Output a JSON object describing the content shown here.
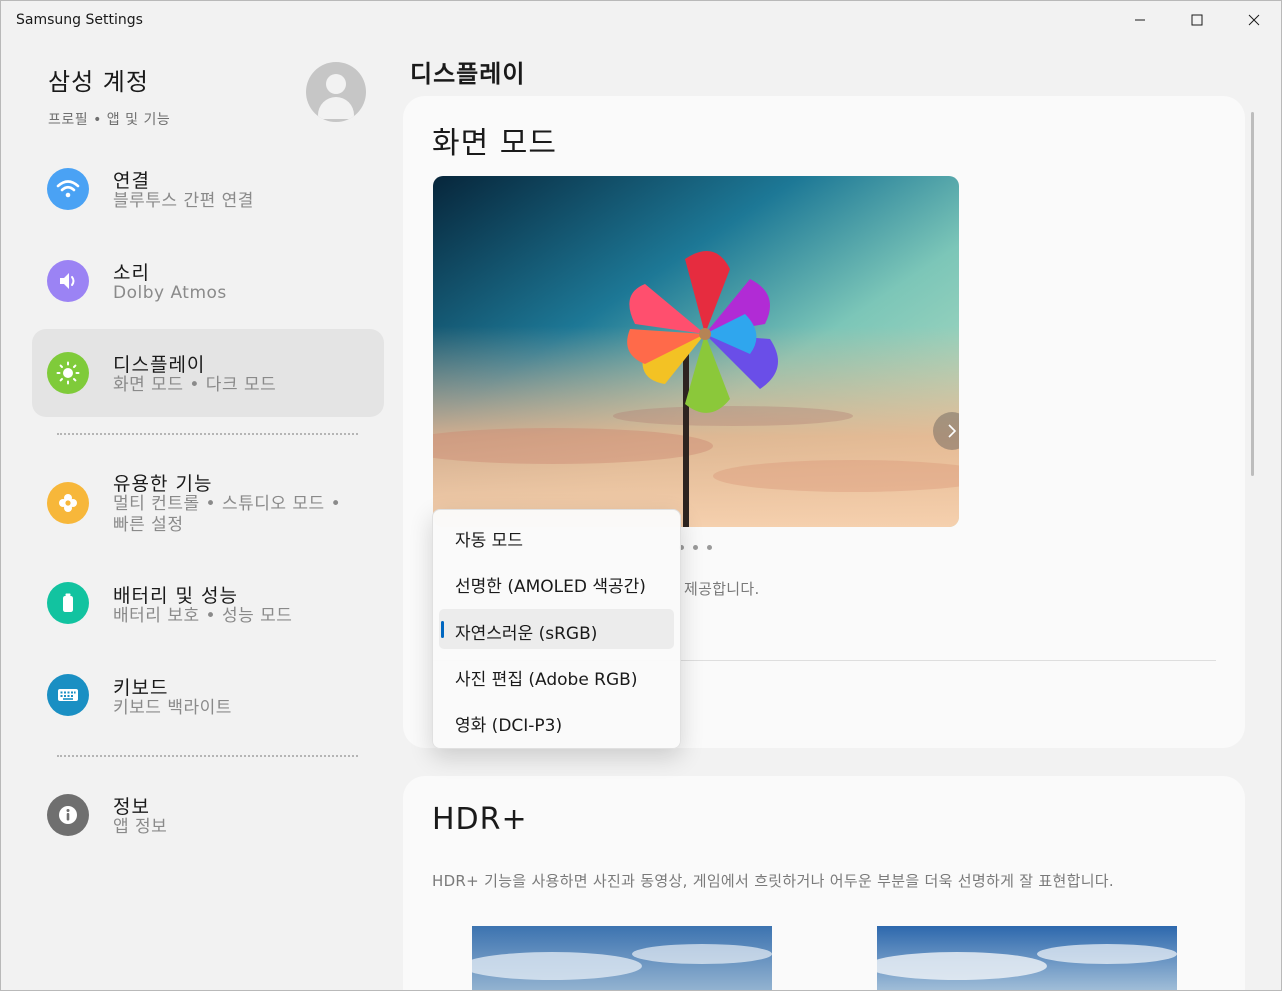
{
  "window": {
    "title": "Samsung Settings",
    "controls": [
      "minimize",
      "maximize",
      "close"
    ]
  },
  "account": {
    "name": "삼성 계정",
    "subtitle": "프로필 • 앱 및 기능"
  },
  "sidebar": {
    "items": [
      {
        "title": "연결",
        "subtitle": "블루투스 간편 연결",
        "icon": "wifi-icon",
        "color": "#4aa2f4"
      },
      {
        "title": "소리",
        "subtitle": "Dolby Atmos",
        "icon": "speaker-icon",
        "color": "#9b83f4"
      },
      {
        "title": "디스플레이",
        "subtitle": "화면 모드 • 다크 모드",
        "icon": "brightness-icon",
        "color": "#7fcb3a",
        "selected": true
      },
      {
        "title": "유용한 기능",
        "subtitle_line1": "멀티 컨트롤 • 스튜디오 모드 •",
        "subtitle_line2": "빠른 설정",
        "icon": "flower-icon",
        "color": "#f7b73a"
      },
      {
        "title": "배터리 및 성능",
        "subtitle": "배터리 보호 • 성능 모드",
        "icon": "battery-icon",
        "color": "#12c3a0"
      },
      {
        "title": "키보드",
        "subtitle": "키보드 백라이트",
        "icon": "keyboard-icon",
        "color": "#1a8fc3"
      },
      {
        "title": "정보",
        "subtitle": "앱 정보",
        "icon": "info-icon",
        "color": "#6f6f6f"
      }
    ]
  },
  "main": {
    "page_title": "디스플레이",
    "screen_mode": {
      "title": "화면 모드",
      "description_visible": "제공합니다.",
      "carousel_pages": 3
    },
    "hdr": {
      "title": "HDR+",
      "description": "HDR+ 기능을 사용하면 사진과 동영상, 게임에서 흐릿하거나 어두운 부분을 더욱 선명하게 잘 표현합니다."
    }
  },
  "dropdown": {
    "selected_index": 2,
    "options": [
      "자동 모드",
      "선명한 (AMOLED 색공간)",
      "자연스러운 (sRGB)",
      "사진 편집 (Adobe RGB)",
      "영화 (DCI-P3)"
    ]
  },
  "colors": {
    "accent": "#0067c0",
    "selected_nav_bg": "#e4e4e4",
    "card_bg": "#fafafa"
  }
}
